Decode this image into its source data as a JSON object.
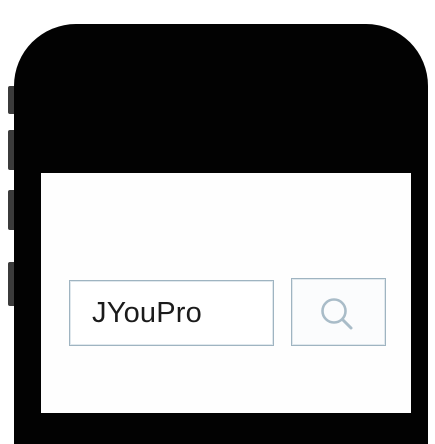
{
  "search": {
    "value": "JYouPro"
  },
  "icons": {
    "search_button": "search-icon"
  },
  "colors": {
    "phone_body": "#020202",
    "screen": "#fefefe",
    "field_border": "#9fb4c1",
    "icon": "#a9bcc8"
  }
}
